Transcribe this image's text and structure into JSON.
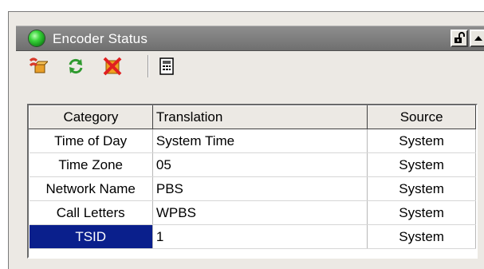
{
  "panel": {
    "title": "Encoder Status",
    "status_color": "#2ecc40"
  },
  "toolbar": {
    "icons": [
      "configure-icon",
      "refresh-icon",
      "delete-icon",
      "report-icon"
    ]
  },
  "grid": {
    "headers": [
      "Category",
      "Translation",
      "Source"
    ],
    "rows": [
      {
        "category": "Time of Day",
        "translation": "System Time",
        "source": "System"
      },
      {
        "category": "Time Zone",
        "translation": "05",
        "source": "System"
      },
      {
        "category": "Network Name",
        "translation": "PBS",
        "source": "System"
      },
      {
        "category": "Call Letters",
        "translation": "WPBS",
        "source": "System"
      },
      {
        "category": "TSID",
        "translation": "1",
        "source": "System",
        "selected": true
      }
    ],
    "selection_color": "#0a1f8c"
  }
}
